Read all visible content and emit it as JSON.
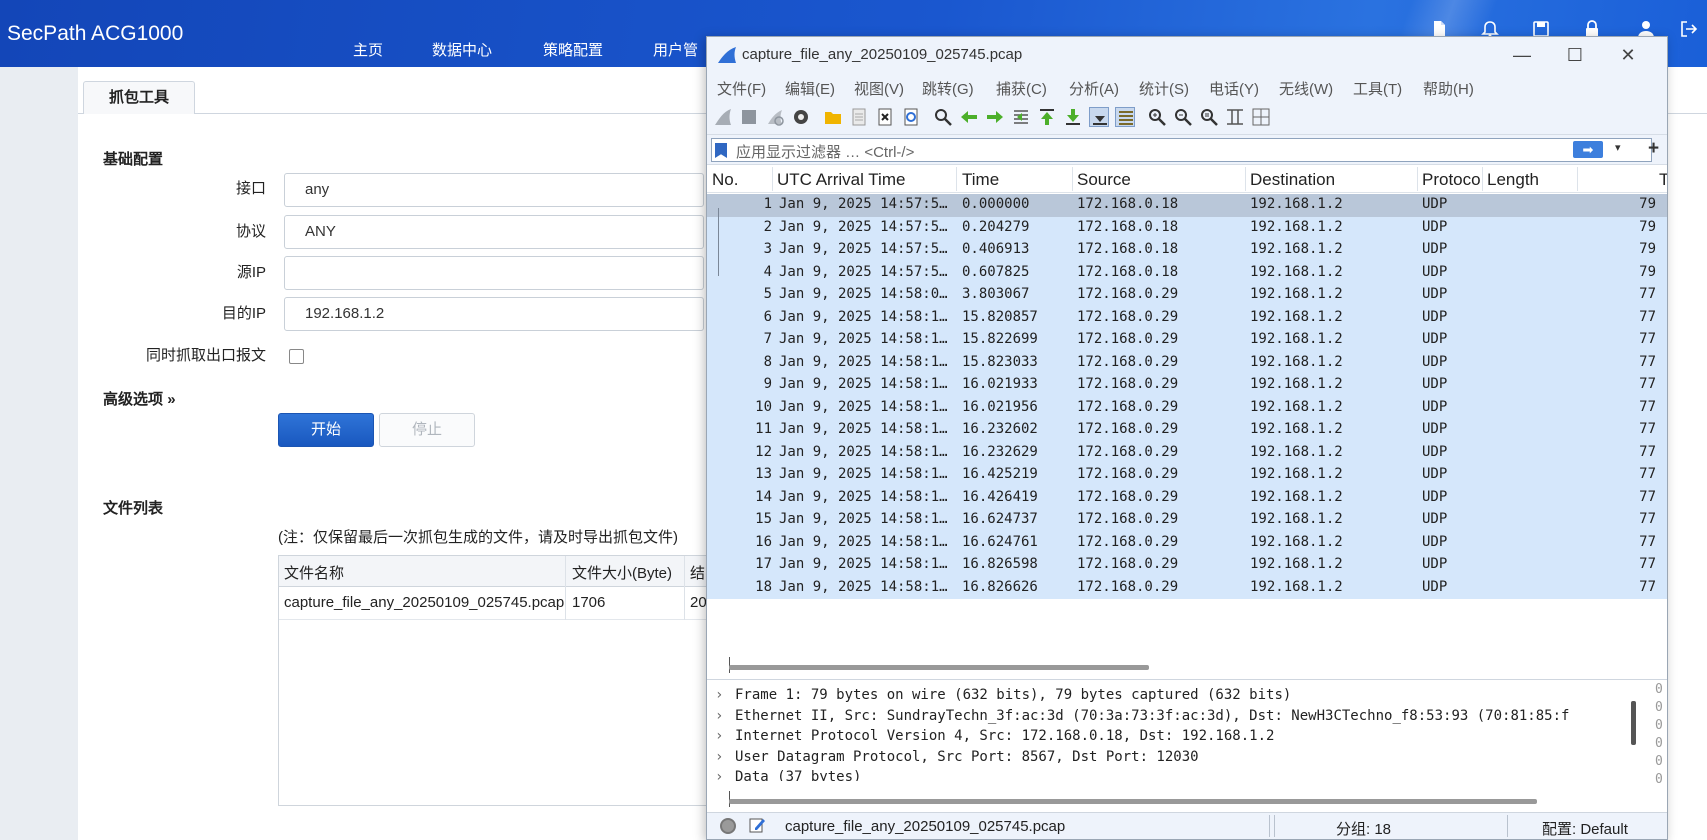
{
  "app": {
    "brand": "SecPath ACG1000",
    "nav": [
      "主页",
      "数据中心",
      "策略配置",
      "用户管"
    ],
    "tab": "抓包工具"
  },
  "form": {
    "section_basic": "基础配置",
    "interface_label": "接口",
    "interface_value": "any",
    "protocol_label": "协议",
    "protocol_value": "ANY",
    "src_ip_label": "源IP",
    "src_ip_value": "",
    "dst_ip_label": "目的IP",
    "dst_ip_value": "192.168.1.2",
    "egress_label": "同时抓取出口报文",
    "advanced_label": "高级选项",
    "advanced_chevron": "»",
    "start_label": "开始",
    "stop_label": "停止"
  },
  "files": {
    "section_title": "文件列表",
    "note": "(注：仅保留最后一次抓包生成的文件，请及时导出抓包文件)",
    "columns": [
      "文件名称",
      "文件大小(Byte)",
      "结"
    ],
    "rows": [
      {
        "name": "capture_file_any_20250109_025745.pcap",
        "size": "1706",
        "end": "20"
      }
    ]
  },
  "wireshark": {
    "title": "capture_file_any_20250109_025745.pcap",
    "menus": [
      "文件(F)",
      "编辑(E)",
      "视图(V)",
      "跳转(G)",
      "捕获(C)",
      "分析(A)",
      "统计(S)",
      "电话(Y)",
      "无线(W)",
      "工具(T)",
      "帮助(H)"
    ],
    "toolbar_icons": [
      "shark-fin-icon",
      "stop-icon",
      "restart-icon",
      "options-icon",
      "open-folder-icon",
      "file-icon",
      "close-file-icon",
      "reload-icon",
      "find-icon",
      "back-icon",
      "forward-icon",
      "goto-icon",
      "first-icon",
      "last-icon",
      "autoscroll-icon",
      "colorize-icon",
      "zoom-in-icon",
      "zoom-out-icon",
      "zoom-reset-icon",
      "resize-columns-icon",
      "layout-icon"
    ],
    "filter_placeholder": "应用显示过滤器 … <Ctrl-/>",
    "filter_apply": "➡",
    "filter_dropdown": "▾",
    "filter_add": "+",
    "columns": [
      "No.",
      "UTC Arrival Time",
      "Time",
      "Source",
      "Destination",
      "Protoco",
      "Length",
      "T"
    ],
    "packets": [
      {
        "no": "1",
        "utc": "Jan  9, 2025 14:57:5…",
        "time": "0.000000",
        "src": "172.168.0.18",
        "dst": "192.168.1.2",
        "proto": "UDP",
        "len": "79"
      },
      {
        "no": "2",
        "utc": "Jan  9, 2025 14:57:5…",
        "time": "0.204279",
        "src": "172.168.0.18",
        "dst": "192.168.1.2",
        "proto": "UDP",
        "len": "79"
      },
      {
        "no": "3",
        "utc": "Jan  9, 2025 14:57:5…",
        "time": "0.406913",
        "src": "172.168.0.18",
        "dst": "192.168.1.2",
        "proto": "UDP",
        "len": "79"
      },
      {
        "no": "4",
        "utc": "Jan  9, 2025 14:57:5…",
        "time": "0.607825",
        "src": "172.168.0.18",
        "dst": "192.168.1.2",
        "proto": "UDP",
        "len": "79"
      },
      {
        "no": "5",
        "utc": "Jan  9, 2025 14:58:0…",
        "time": "3.803067",
        "src": "172.168.0.29",
        "dst": "192.168.1.2",
        "proto": "UDP",
        "len": "77"
      },
      {
        "no": "6",
        "utc": "Jan  9, 2025 14:58:1…",
        "time": "15.820857",
        "src": "172.168.0.29",
        "dst": "192.168.1.2",
        "proto": "UDP",
        "len": "77"
      },
      {
        "no": "7",
        "utc": "Jan  9, 2025 14:58:1…",
        "time": "15.822699",
        "src": "172.168.0.29",
        "dst": "192.168.1.2",
        "proto": "UDP",
        "len": "77"
      },
      {
        "no": "8",
        "utc": "Jan  9, 2025 14:58:1…",
        "time": "15.823033",
        "src": "172.168.0.29",
        "dst": "192.168.1.2",
        "proto": "UDP",
        "len": "77"
      },
      {
        "no": "9",
        "utc": "Jan  9, 2025 14:58:1…",
        "time": "16.021933",
        "src": "172.168.0.29",
        "dst": "192.168.1.2",
        "proto": "UDP",
        "len": "77"
      },
      {
        "no": "10",
        "utc": "Jan  9, 2025 14:58:1…",
        "time": "16.021956",
        "src": "172.168.0.29",
        "dst": "192.168.1.2",
        "proto": "UDP",
        "len": "77"
      },
      {
        "no": "11",
        "utc": "Jan  9, 2025 14:58:1…",
        "time": "16.232602",
        "src": "172.168.0.29",
        "dst": "192.168.1.2",
        "proto": "UDP",
        "len": "77"
      },
      {
        "no": "12",
        "utc": "Jan  9, 2025 14:58:1…",
        "time": "16.232629",
        "src": "172.168.0.29",
        "dst": "192.168.1.2",
        "proto": "UDP",
        "len": "77"
      },
      {
        "no": "13",
        "utc": "Jan  9, 2025 14:58:1…",
        "time": "16.425219",
        "src": "172.168.0.29",
        "dst": "192.168.1.2",
        "proto": "UDP",
        "len": "77"
      },
      {
        "no": "14",
        "utc": "Jan  9, 2025 14:58:1…",
        "time": "16.426419",
        "src": "172.168.0.29",
        "dst": "192.168.1.2",
        "proto": "UDP",
        "len": "77"
      },
      {
        "no": "15",
        "utc": "Jan  9, 2025 14:58:1…",
        "time": "16.624737",
        "src": "172.168.0.29",
        "dst": "192.168.1.2",
        "proto": "UDP",
        "len": "77"
      },
      {
        "no": "16",
        "utc": "Jan  9, 2025 14:58:1…",
        "time": "16.624761",
        "src": "172.168.0.29",
        "dst": "192.168.1.2",
        "proto": "UDP",
        "len": "77"
      },
      {
        "no": "17",
        "utc": "Jan  9, 2025 14:58:1…",
        "time": "16.826598",
        "src": "172.168.0.29",
        "dst": "192.168.1.2",
        "proto": "UDP",
        "len": "77"
      },
      {
        "no": "18",
        "utc": "Jan  9, 2025 14:58:1…",
        "time": "16.826626",
        "src": "172.168.0.29",
        "dst": "192.168.1.2",
        "proto": "UDP",
        "len": "77"
      }
    ],
    "details": [
      "Frame 1: 79 bytes on wire (632 bits), 79 bytes captured (632 bits)",
      "Ethernet II, Src: SundrayTechn_3f:ac:3d (70:3a:73:3f:ac:3d), Dst: NewH3CTechno_f8:53:93 (70:81:85:f",
      "Internet Protocol Version 4, Src: 172.168.0.18, Dst: 192.168.1.2",
      "User Datagram Protocol, Src Port: 8567, Dst Port: 12030",
      "Data (37 bytes)"
    ],
    "detail_chevron": "›",
    "bytes_glyphs": [
      "0",
      "0",
      "0",
      "0",
      "0",
      "0"
    ],
    "status": {
      "file": "capture_file_any_20250109_025745.pcap",
      "packets": "分组: 18",
      "profile": "配置: Default"
    },
    "colors": {
      "row_bg": "#d5e7fb",
      "row_selected": "#b9c7d9",
      "accent": "#2f6fd6"
    }
  }
}
